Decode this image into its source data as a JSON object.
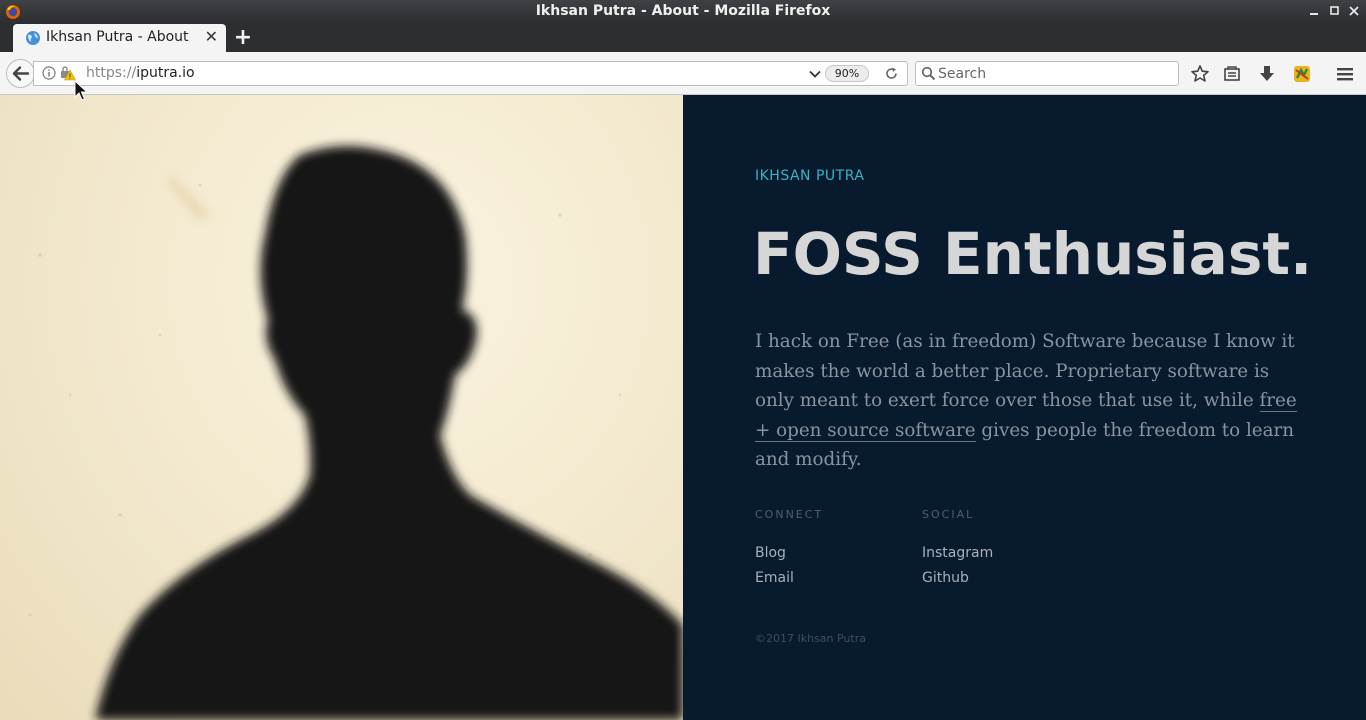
{
  "window": {
    "title": "Ikhsan Putra - About - Mozilla Firefox",
    "icons": [
      "firefox-icon",
      "minimize-icon",
      "maximize-icon",
      "close-icon"
    ]
  },
  "tabs": [
    {
      "label": "Ikhsan Putra - About",
      "active": true,
      "icon": "globe-icon"
    }
  ],
  "navbar": {
    "url_scheme": "https://",
    "url_host": "iputra.io",
    "zoom": "90%",
    "search_placeholder": "Search",
    "toolbar_icons": [
      "bookmark-star-icon",
      "library-icon",
      "download-icon",
      "extension-icon",
      "hamburger-menu-icon"
    ]
  },
  "page": {
    "site_name": "IKHSAN PUTRA",
    "headline": "FOSS Enthusiast.",
    "bio_before": "I hack on Free (as in freedom) Software because I know it makes the world a better place. Proprietary software is only meant to exert force over those that use it, while ",
    "bio_link": "free + open source software",
    "bio_after": " gives people the freedom to learn and modify.",
    "connect": {
      "heading": "CONNECT",
      "links": [
        "Blog",
        "Email"
      ]
    },
    "social": {
      "heading": "SOCIAL",
      "links": [
        "Instagram",
        "Github"
      ]
    },
    "copyright": "©2017 Ikhsan Putra"
  },
  "colors": {
    "panel_bg": "#081b2e",
    "accent": "#38b2c8",
    "headline": "#d6d6d6",
    "body_text": "#8a93a0"
  }
}
